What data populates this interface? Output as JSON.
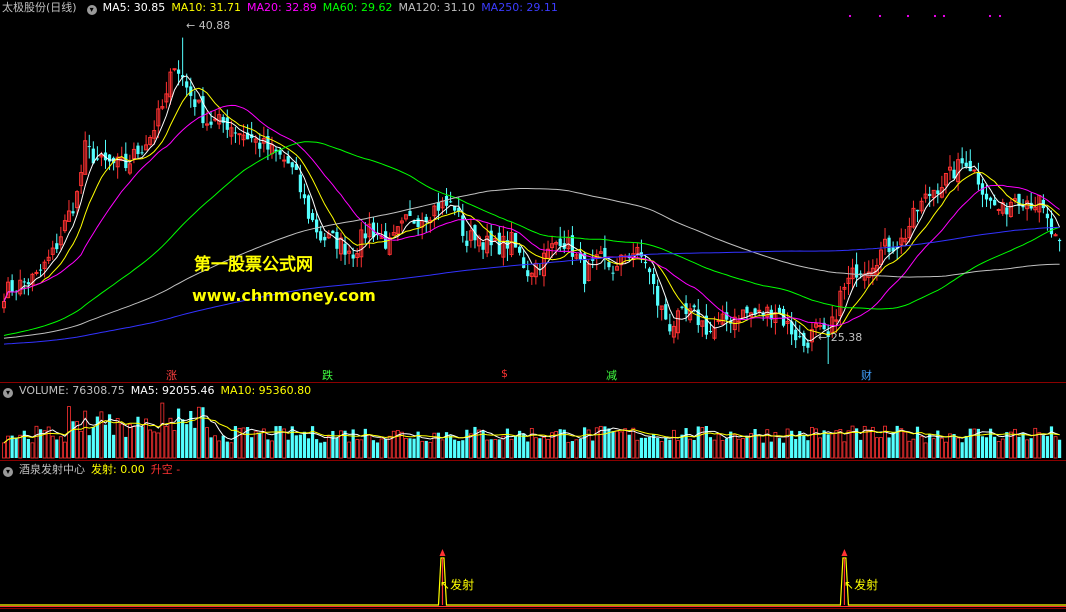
{
  "main_legend": {
    "stock": "太极股份(日线)",
    "ma5": "MA5: 30.85",
    "ma10": "MA10: 31.71",
    "ma20": "MA20: 32.89",
    "ma60": "MA60: 29.62",
    "ma120": "MA120: 31.10",
    "ma250": "MA250: 29.11",
    "control_icon": "chevron-down-icon"
  },
  "vol_legend": {
    "volume": "VOLUME: 76308.75",
    "ma5": "MA5: 92055.46",
    "ma10": "MA10: 95360.80"
  },
  "ind_legend": {
    "name": "酒泉发射中心",
    "fashe": "发射: 0.00",
    "shengkong": "升空 -"
  },
  "annotations": {
    "high": "40.88",
    "low": "25.38",
    "zhang": "涨",
    "die": "跌",
    "dollar": "$",
    "jian": "减",
    "cai": "财",
    "fashe1": "发射",
    "fashe2": "发射"
  },
  "watermark": {
    "line1": "第一股票公式网",
    "line2": "www.chnmoney.com"
  },
  "colors": {
    "up": "#ff3232",
    "down": "#54ffff",
    "ma5": "#ffffff",
    "ma10": "#ffff00",
    "ma20": "#ff00ff",
    "ma60": "#00ff00",
    "ma120": "#c0c0c0",
    "ma250": "#3232ff"
  },
  "chart_data": [
    {
      "type": "candlestick",
      "title": "太极股份(日线)",
      "ylim": [
        25.0,
        42.0
      ],
      "high_marker": 40.88,
      "low_marker": 25.38,
      "close_anchors": [
        [
          0,
          28.8
        ],
        [
          8,
          29.5
        ],
        [
          12,
          30.6
        ],
        [
          18,
          33.4
        ],
        [
          20,
          35.6
        ],
        [
          24,
          34.9
        ],
        [
          30,
          34.8
        ],
        [
          36,
          36.2
        ],
        [
          40,
          38.0
        ],
        [
          42,
          39.8
        ],
        [
          45,
          38.5
        ],
        [
          50,
          36.9
        ],
        [
          55,
          36.8
        ],
        [
          60,
          36.2
        ],
        [
          65,
          35.6
        ],
        [
          68,
          35.2
        ],
        [
          70,
          34.9
        ],
        [
          72,
          34.2
        ],
        [
          75,
          32.5
        ],
        [
          78,
          31.4
        ],
        [
          82,
          31.2
        ],
        [
          86,
          30.7
        ],
        [
          90,
          31.9
        ],
        [
          95,
          31.0
        ],
        [
          99,
          32.1
        ],
        [
          103,
          32.4
        ],
        [
          107,
          32.9
        ],
        [
          111,
          32.9
        ],
        [
          114,
          31.1
        ],
        [
          116,
          31.6
        ],
        [
          120,
          30.9
        ],
        [
          125,
          31.2
        ],
        [
          129,
          29.8
        ],
        [
          133,
          30.4
        ],
        [
          137,
          31.4
        ],
        [
          140,
          30.8
        ],
        [
          143,
          29.6
        ],
        [
          147,
          30.3
        ],
        [
          151,
          29.8
        ],
        [
          153,
          30.6
        ],
        [
          155,
          30.7
        ],
        [
          158,
          30.3
        ],
        [
          161,
          28.3
        ],
        [
          164,
          27.2
        ],
        [
          167,
          27.6
        ],
        [
          170,
          27.7
        ],
        [
          174,
          26.9
        ],
        [
          178,
          27.5
        ],
        [
          182,
          27.8
        ],
        [
          186,
          27.7
        ],
        [
          190,
          28.0
        ],
        [
          193,
          27.2
        ],
        [
          197,
          26.3
        ],
        [
          200,
          27.0
        ],
        [
          203,
          26.5
        ],
        [
          206,
          28.6
        ],
        [
          210,
          29.9
        ],
        [
          213,
          30.1
        ],
        [
          217,
          30.9
        ],
        [
          221,
          31.2
        ],
        [
          225,
          32.7
        ],
        [
          229,
          33.7
        ],
        [
          233,
          34.3
        ],
        [
          237,
          35.1
        ],
        [
          240,
          34.2
        ],
        [
          243,
          33.0
        ],
        [
          246,
          32.6
        ],
        [
          249,
          33.4
        ],
        [
          252,
          33.2
        ],
        [
          255,
          33.0
        ],
        [
          258,
          31.6
        ],
        [
          260,
          30.8
        ]
      ],
      "series": [
        {
          "name": "MA5",
          "value": 30.85
        },
        {
          "name": "MA10",
          "value": 31.71
        },
        {
          "name": "MA20",
          "value": 32.89
        },
        {
          "name": "MA60",
          "value": 29.62
        },
        {
          "name": "MA120",
          "value": 31.1
        },
        {
          "name": "MA250",
          "value": 29.11
        }
      ]
    },
    {
      "type": "bar",
      "title": "VOLUME",
      "last_value": 76308.75,
      "series": [
        {
          "name": "MA5",
          "value": 92055.46
        },
        {
          "name": "MA10",
          "value": 95360.8
        }
      ]
    },
    {
      "type": "line",
      "title": "酒泉发射中心",
      "series": [
        {
          "name": "发射",
          "last_value": 0.0,
          "spikes_at_candle": [
            108,
            207
          ]
        }
      ]
    }
  ]
}
